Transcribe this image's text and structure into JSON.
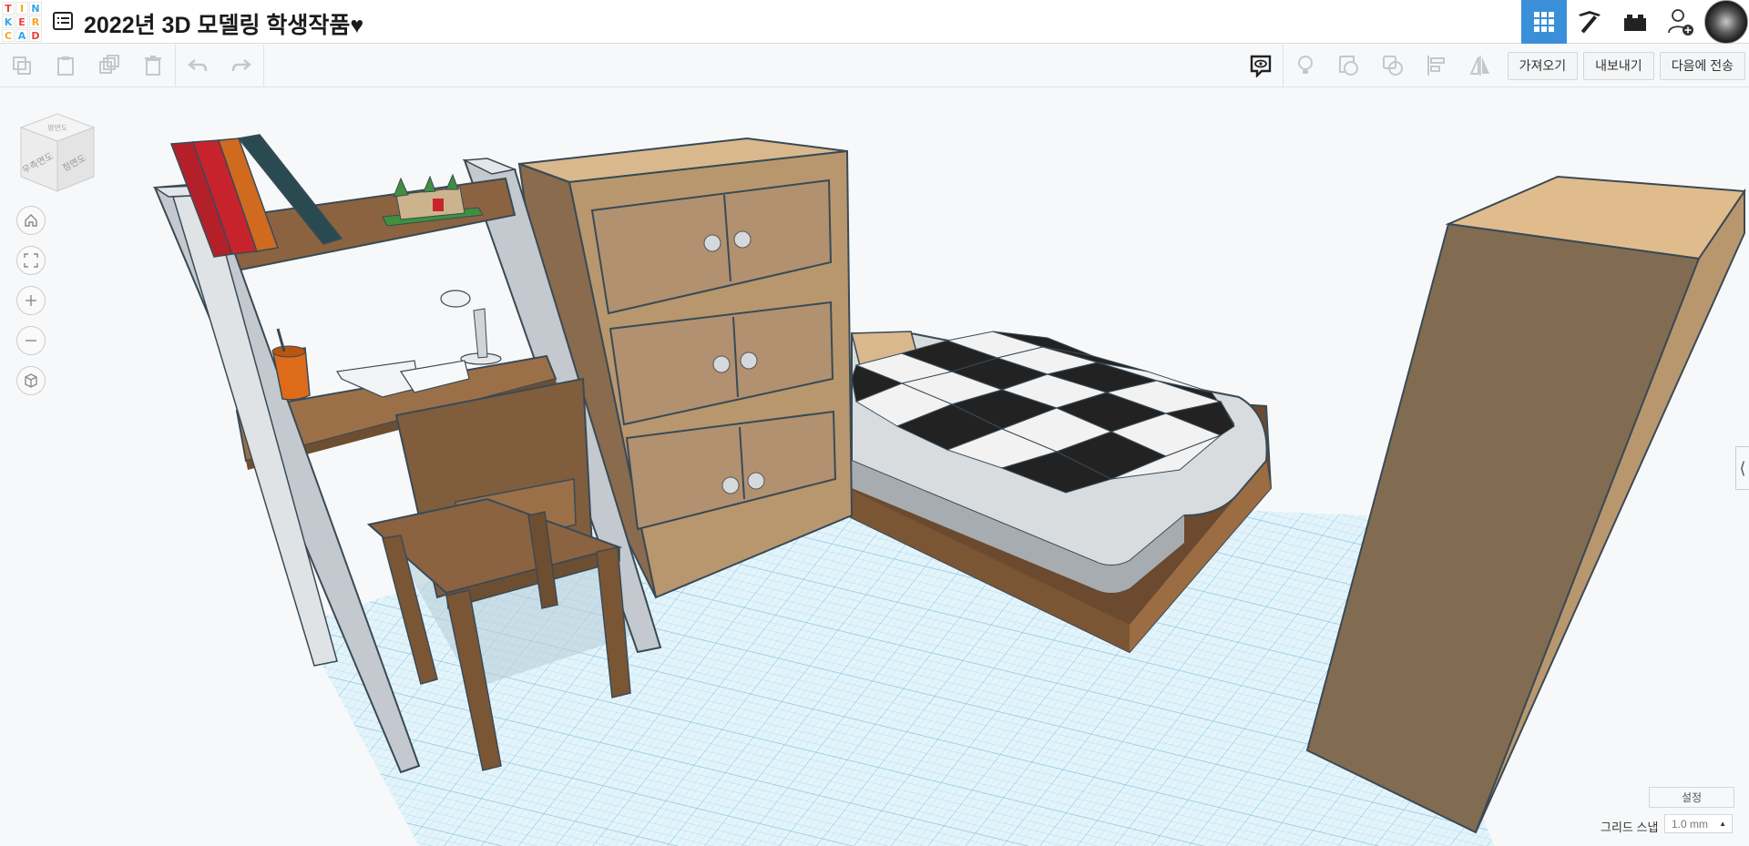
{
  "app": {
    "logo_letters": [
      "T",
      "I",
      "N",
      "K",
      "E",
      "R",
      "C",
      "A",
      "D"
    ],
    "logo_colors": [
      "#e8413a",
      "#f6a623",
      "#35a8e0",
      "#e8413a",
      "#f6a623",
      "#35a8e0",
      "#e8413a",
      "#f6a623",
      "#35a8e0"
    ],
    "doc_title": "2022년 3D 모델링 학생작품♥"
  },
  "top_nav": {
    "items": [
      {
        "name": "grid-view-icon",
        "active": true
      },
      {
        "name": "pickaxe-icon",
        "active": false
      },
      {
        "name": "bricks-icon",
        "active": false
      },
      {
        "name": "add-user-icon",
        "active": false
      }
    ]
  },
  "toolbar": {
    "import_label": "가져오기",
    "export_label": "내보내기",
    "send_to_label": "다음에 전송"
  },
  "viewcube": {
    "front_label": "정면도",
    "right_label": "우측면도",
    "top_label": "평면도"
  },
  "bottom": {
    "settings_label": "설정",
    "grid_snap_label": "그리드 스냅",
    "grid_snap_value": "1.0 mm"
  },
  "colors": {
    "accent": "#3b8fd9",
    "grid": "#bfe3f1",
    "wood_light": "#b99b74",
    "wood_dark": "#8b6341"
  }
}
